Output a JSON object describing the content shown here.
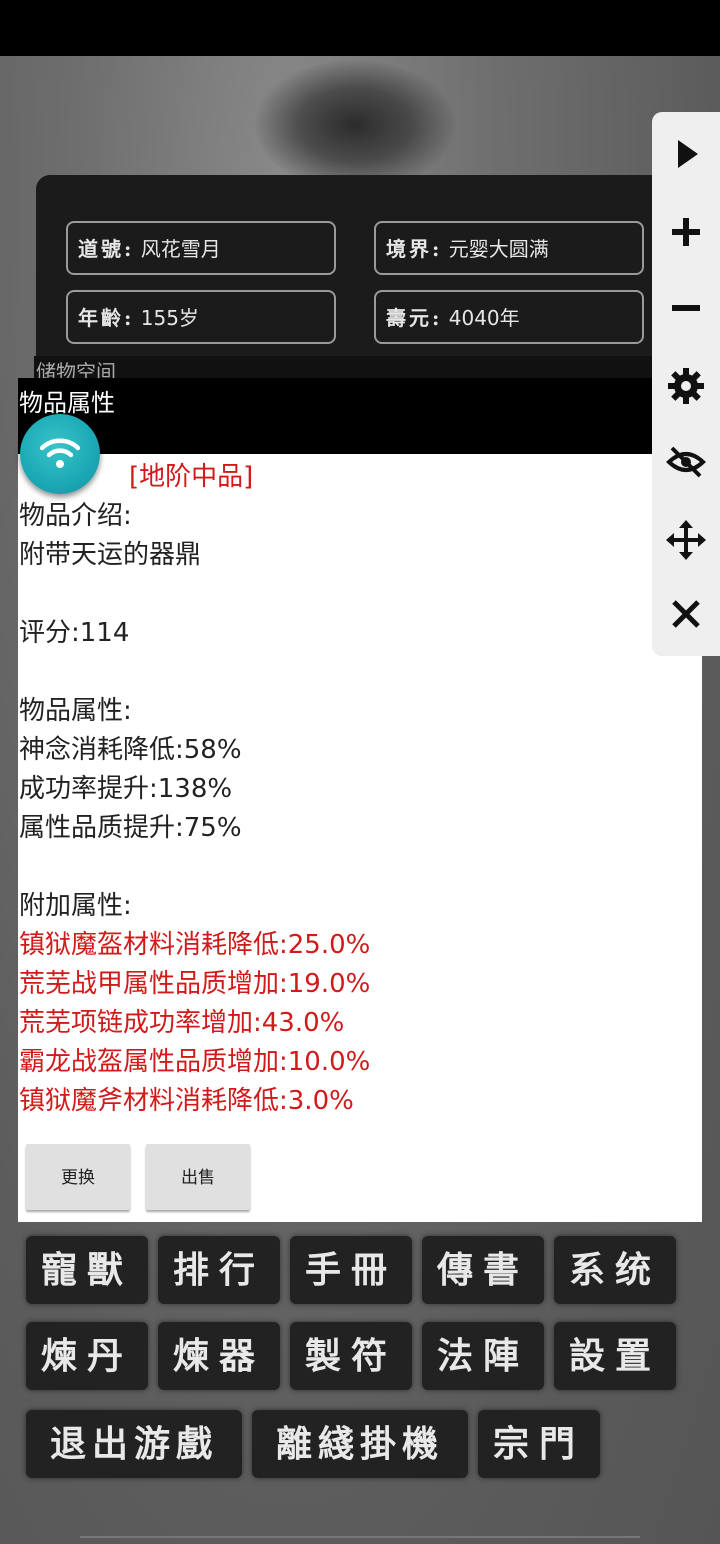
{
  "player_info": {
    "daohao_label": "道號:",
    "daohao_value": "风花雪月",
    "jingjie_label": "境界:",
    "jingjie_value": "元婴大圆满",
    "nianling_label": "年齡:",
    "nianling_value": "155岁",
    "shouyuan_label": "壽元:",
    "shouyuan_value": "4040年"
  },
  "storage_tab": {
    "label": "储物空间"
  },
  "dialog": {
    "title": "物品属性",
    "grade": "[地阶中品]",
    "intro_label": "物品介绍:",
    "intro_text": "附带天运的器鼎",
    "score": "评分:114",
    "attrs_label": "物品属性:",
    "attrs": [
      "神念消耗降低:58%",
      "成功率提升:138%",
      "属性品质提升:75%"
    ],
    "extra_label": "附加属性:",
    "extra_attrs": [
      "镇狱魔盔材料消耗降低:25.0%",
      "荒芜战甲属性品质增加:19.0%",
      "荒芜项链成功率增加:43.0%",
      "霸龙战盔属性品质增加:10.0%",
      "镇狱魔斧材料消耗降低:3.0%"
    ],
    "replace_button": "更换",
    "sell_button": "出售"
  },
  "main_menu": {
    "row1": [
      "寵獸",
      "排行",
      "手冊",
      "傳書",
      "系统"
    ],
    "row2": [
      "煉丹",
      "煉器",
      "製符",
      "法陣",
      "設置"
    ],
    "row3": [
      "退出游戲",
      "離綫掛機",
      "宗門"
    ]
  },
  "toolbar_icons": [
    "play-icon",
    "zoom-in-icon",
    "zoom-out-icon",
    "settings-icon",
    "hide-icon",
    "move-icon",
    "close-icon"
  ],
  "floating_button_icon": "wifi-icon",
  "colors": {
    "accent_teal": "#1ba8b5",
    "red_text": "#d11a1a",
    "dialog_header": "#000000",
    "menu_button": "#222222"
  }
}
